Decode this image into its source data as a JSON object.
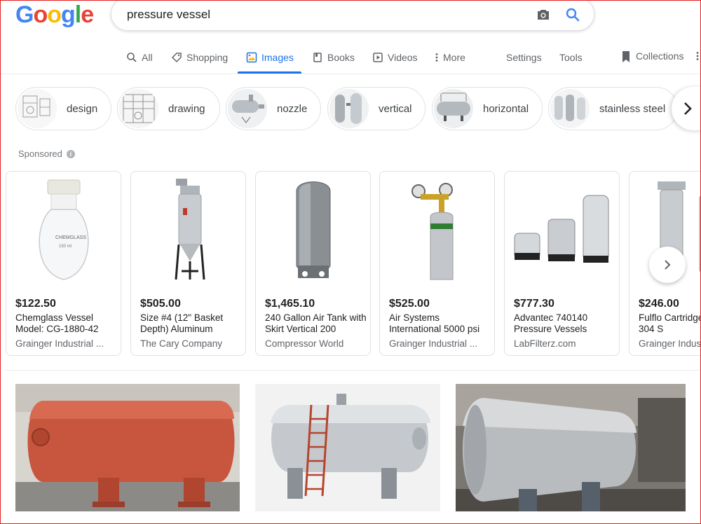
{
  "search": {
    "query": "pressure vessel"
  },
  "tabs": [
    {
      "label": "All",
      "icon": "search-icon"
    },
    {
      "label": "Shopping",
      "icon": "tag-icon"
    },
    {
      "label": "Images",
      "icon": "image-icon",
      "active": true
    },
    {
      "label": "Books",
      "icon": "book-icon"
    },
    {
      "label": "Videos",
      "icon": "play-icon"
    },
    {
      "label": "More",
      "icon": "dots-vertical-icon"
    }
  ],
  "tools": {
    "settings": "Settings",
    "tools": "Tools",
    "collections": "Collections"
  },
  "chips": [
    "design",
    "drawing",
    "nozzle",
    "vertical",
    "horizontal",
    "stainless steel"
  ],
  "sponsored": {
    "label": "Sponsored"
  },
  "products": [
    {
      "price": "$122.50",
      "title": "Chemglass Vessel Model: CG-1880-42",
      "seller": "Grainger Industrial ..."
    },
    {
      "price": "$505.00",
      "title": "Size #4 (12\" Basket Depth) Aluminum",
      "seller": "The Cary Company"
    },
    {
      "price": "$1,465.10",
      "title": "240 Gallon Air Tank with Skirt Vertical 200",
      "seller": "Compressor World"
    },
    {
      "price": "$525.00",
      "title": "Air Systems International 5000 psi",
      "seller": "Grainger Industrial ..."
    },
    {
      "price": "$777.30",
      "title": "Advantec 740140 Pressure Vessels",
      "seller": "LabFilterz.com"
    },
    {
      "price": "$246.00",
      "title": "Fulflo Cartridge Vessel, 304 S",
      "seller": "Grainger Indus"
    }
  ],
  "colors": {
    "accent": "#1a73e8",
    "google_blue": "#4285f4",
    "google_red": "#ea4335",
    "google_yellow": "#fbbc05",
    "google_green": "#34a853"
  }
}
